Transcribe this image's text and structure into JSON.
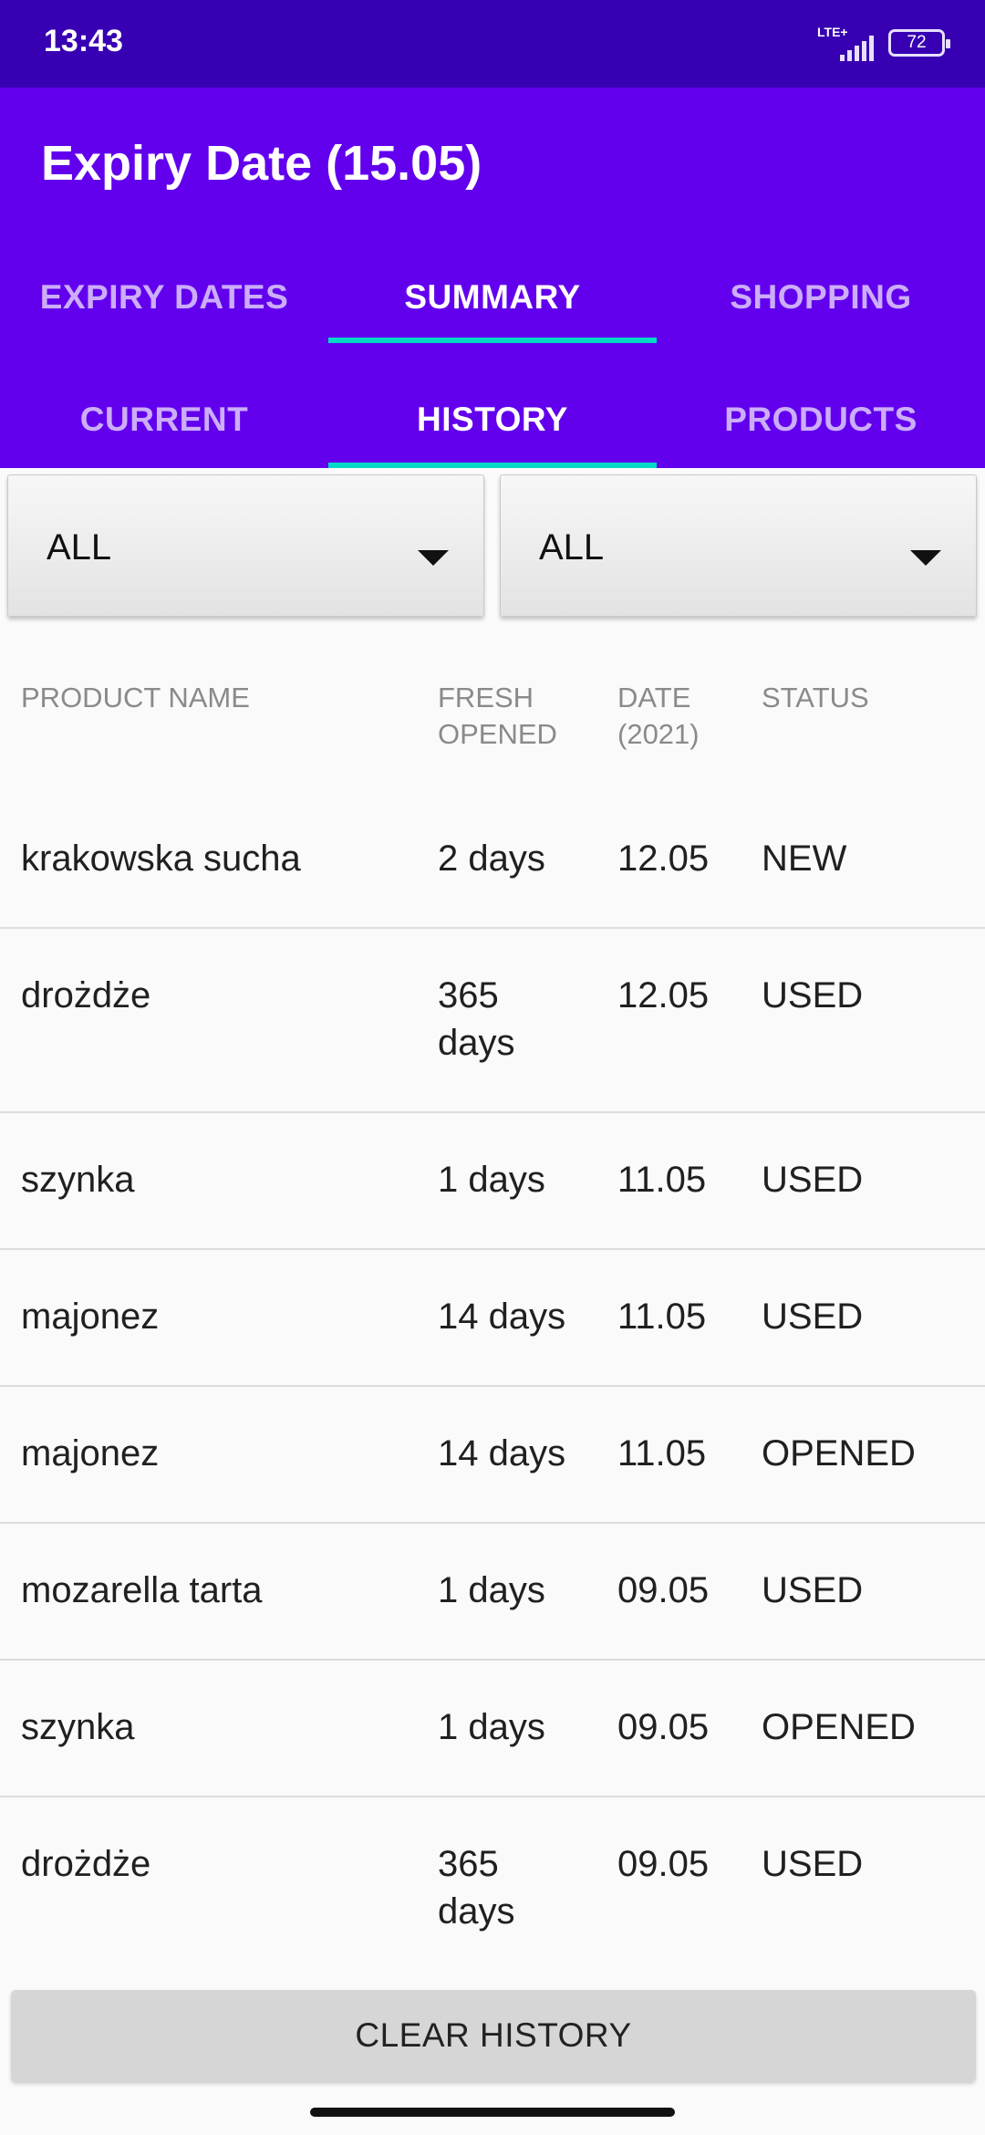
{
  "status_bar": {
    "time": "13:43",
    "network": "LTE+",
    "battery": "72"
  },
  "app": {
    "title": "Expiry Date (15.05)"
  },
  "tabs": [
    {
      "label": "EXPIRY DATES",
      "active": false
    },
    {
      "label": "SUMMARY",
      "active": true
    },
    {
      "label": "SHOPPING",
      "active": false
    }
  ],
  "subtabs": [
    {
      "label": "CURRENT",
      "active": false
    },
    {
      "label": "HISTORY",
      "active": true
    },
    {
      "label": "PRODUCTS",
      "active": false
    }
  ],
  "filters": [
    {
      "value": "ALL"
    },
    {
      "value": "ALL"
    }
  ],
  "table": {
    "headers": {
      "name": "PRODUCT NAME",
      "fresh": "FRESH\nOPENED",
      "date": "DATE\n(2021)",
      "status": "STATUS"
    },
    "rows": [
      {
        "name": "krakowska sucha",
        "fresh": "2 days",
        "date": "12.05",
        "status": "NEW"
      },
      {
        "name": "drożdże",
        "fresh": "365\ndays",
        "date": "12.05",
        "status": "USED"
      },
      {
        "name": "szynka",
        "fresh": "1 days",
        "date": "11.05",
        "status": "USED"
      },
      {
        "name": "majonez",
        "fresh": "14 days",
        "date": "11.05",
        "status": "USED"
      },
      {
        "name": "majonez",
        "fresh": "14 days",
        "date": "11.05",
        "status": "OPENED"
      },
      {
        "name": "mozarella tarta",
        "fresh": "1 days",
        "date": "09.05",
        "status": "USED"
      },
      {
        "name": "szynka",
        "fresh": "1 days",
        "date": "09.05",
        "status": "OPENED"
      },
      {
        "name": "drożdże",
        "fresh": "365\ndays",
        "date": "09.05",
        "status": "USED"
      }
    ]
  },
  "clear_button": {
    "label": "CLEAR HISTORY"
  },
  "colors": {
    "status_bar": "#3700b3",
    "app_bar": "#6200ee",
    "tab_indicator": "#03dac5"
  }
}
